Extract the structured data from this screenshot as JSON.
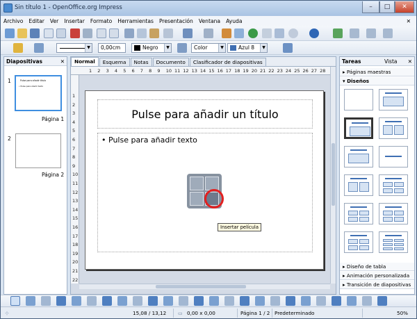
{
  "window": {
    "title": "Sin título 1 - OpenOffice.org Impress",
    "controls": [
      "–",
      "□",
      "✕"
    ]
  },
  "menu": {
    "items": [
      "Archivo",
      "Editar",
      "Ver",
      "Insertar",
      "Formato",
      "Herramientas",
      "Presentación",
      "Ventana",
      "Ayuda"
    ],
    "close": "✕"
  },
  "line_toolbar": {
    "line_width": "0,00cm",
    "line_color": "Negro",
    "fill_type": "Color",
    "fill_color": "Azul 8"
  },
  "slides_panel": {
    "title": "Diapositivas",
    "close": "✕",
    "slides": [
      {
        "number": "1",
        "label": "Página 1",
        "mini_title": "Pulse para añadir título",
        "mini_text": "• Pulse para añadir texto"
      },
      {
        "number": "2",
        "label": "Página 2"
      }
    ]
  },
  "tabs": [
    "Normal",
    "Esquema",
    "Notas",
    "Documento",
    "Clasificador de diapositivas"
  ],
  "active_tab": "Normal",
  "ruler": {
    "horizontal": [
      "1",
      "2",
      "3",
      "4",
      "5",
      "6",
      "7",
      "8",
      "9",
      "10",
      "11",
      "12",
      "13",
      "14",
      "15",
      "16",
      "17",
      "18",
      "19",
      "20",
      "21",
      "22",
      "23",
      "24",
      "25",
      "26",
      "27",
      "28"
    ],
    "vertical": [
      "1",
      "2",
      "3",
      "4",
      "5",
      "6",
      "7",
      "8",
      "9",
      "10",
      "11",
      "12",
      "13",
      "14",
      "15",
      "16",
      "17",
      "18",
      "19",
      "20",
      "21",
      "22"
    ]
  },
  "slide": {
    "title_placeholder": "Pulse para añadir un título",
    "body_placeholder": "Pulse para añadir texto",
    "tooltip": "Insertar película"
  },
  "tasks_panel": {
    "title": "Tareas",
    "view": "Vista",
    "close": "✕",
    "sections": [
      "Páginas maestras",
      "Diseños"
    ],
    "bottom_sections": [
      "Diseño de tabla",
      "Animación personalizada",
      "Transición de diapositivas"
    ]
  },
  "status": {
    "position": "15,08 / 13,12",
    "size": "0,00 x 0,00",
    "page": "Página 1 / 2",
    "layout": "Predeterminado",
    "zoom": "50%"
  },
  "colors": {
    "accent": "#3f6fb3",
    "highlight": "#e22020",
    "tooltip_bg": "#fffbe1"
  }
}
